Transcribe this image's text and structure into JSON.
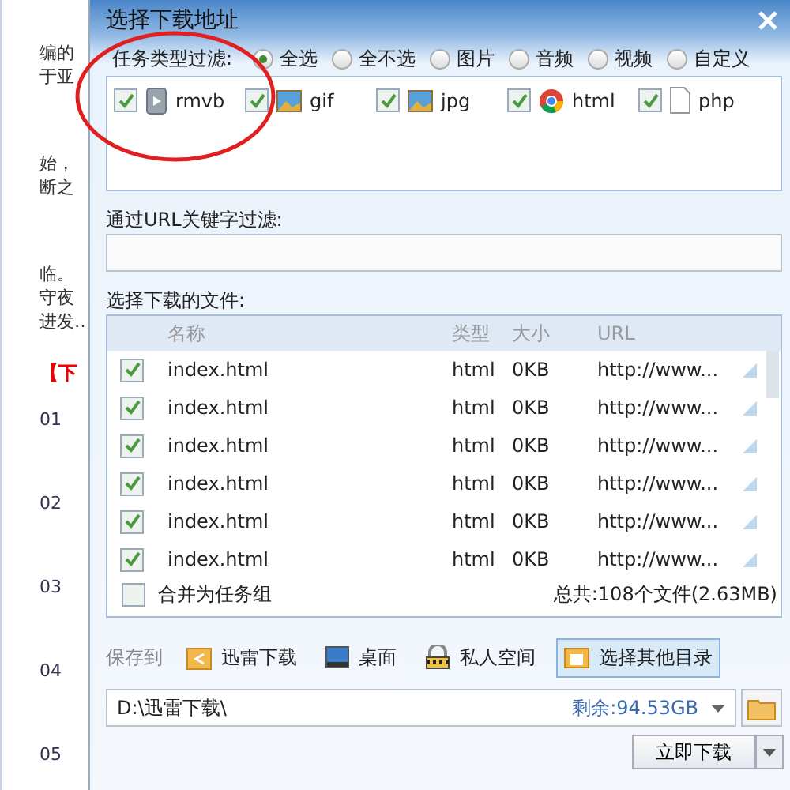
{
  "background_page": {
    "lines": [
      {
        "kind": "text",
        "text": "编的"
      },
      {
        "kind": "text",
        "text": "于亚"
      },
      {
        "kind": "text",
        "text": "始，"
      },
      {
        "kind": "text",
        "text": "断之"
      },
      {
        "kind": "text",
        "text": "临。"
      },
      {
        "kind": "text",
        "text": "守夜"
      },
      {
        "kind": "text",
        "text": "进发…"
      },
      {
        "kind": "heading",
        "text": "【下"
      },
      {
        "kind": "number",
        "text": "01"
      },
      {
        "kind": "number",
        "text": "02"
      },
      {
        "kind": "number",
        "text": "03"
      },
      {
        "kind": "number",
        "text": "04"
      },
      {
        "kind": "number",
        "text": "05"
      }
    ]
  },
  "dialog": {
    "title": "选择下载地址",
    "type_filter": {
      "label": "任务类型过滤:",
      "options": [
        {
          "label": "全选",
          "selected": true
        },
        {
          "label": "全不选",
          "selected": false
        },
        {
          "label": "图片",
          "selected": false
        },
        {
          "label": "音频",
          "selected": false
        },
        {
          "label": "视频",
          "selected": false
        },
        {
          "label": "自定义",
          "selected": false
        }
      ],
      "types": [
        {
          "label": "rmvb",
          "kind": "video",
          "checked": true
        },
        {
          "label": "gif",
          "kind": "image",
          "checked": true
        },
        {
          "label": "jpg",
          "kind": "image",
          "checked": true
        },
        {
          "label": "html",
          "kind": "web",
          "checked": true
        },
        {
          "label": "php",
          "kind": "doc",
          "checked": true
        }
      ]
    },
    "url_filter": {
      "label": "通过URL关键字过滤:"
    },
    "files": {
      "label": "选择下载的文件:",
      "columns": [
        "名称",
        "类型",
        "大小",
        "URL"
      ],
      "rows": [
        {
          "checked": true,
          "name": "index.html",
          "type": "html",
          "size": "0KB",
          "url": "http://www..."
        },
        {
          "checked": true,
          "name": "index.html",
          "type": "html",
          "size": "0KB",
          "url": "http://www..."
        },
        {
          "checked": true,
          "name": "index.html",
          "type": "html",
          "size": "0KB",
          "url": "http://www..."
        },
        {
          "checked": true,
          "name": "index.html",
          "type": "html",
          "size": "0KB",
          "url": "http://www..."
        },
        {
          "checked": true,
          "name": "index.html",
          "type": "html",
          "size": "0KB",
          "url": "http://www..."
        },
        {
          "checked": true,
          "name": "index.html",
          "type": "html",
          "size": "0KB",
          "url": "http://www..."
        }
      ],
      "merge": {
        "label": "合并为任务组",
        "checked": false
      },
      "total": "总共:108个文件(2.63MB)"
    },
    "save_to": {
      "label": "保存到",
      "locations": [
        {
          "label": "迅雷下载",
          "kind": "folder",
          "selected": false
        },
        {
          "label": "桌面",
          "kind": "desktop",
          "selected": false
        },
        {
          "label": "私人空间",
          "kind": "lock",
          "selected": false
        },
        {
          "label": "选择其他目录",
          "kind": "browse",
          "selected": true
        }
      ]
    },
    "path": {
      "value": "D:\\迅雷下载\\",
      "free": "剩余:94.53GB"
    },
    "download_button": "立即下载"
  }
}
